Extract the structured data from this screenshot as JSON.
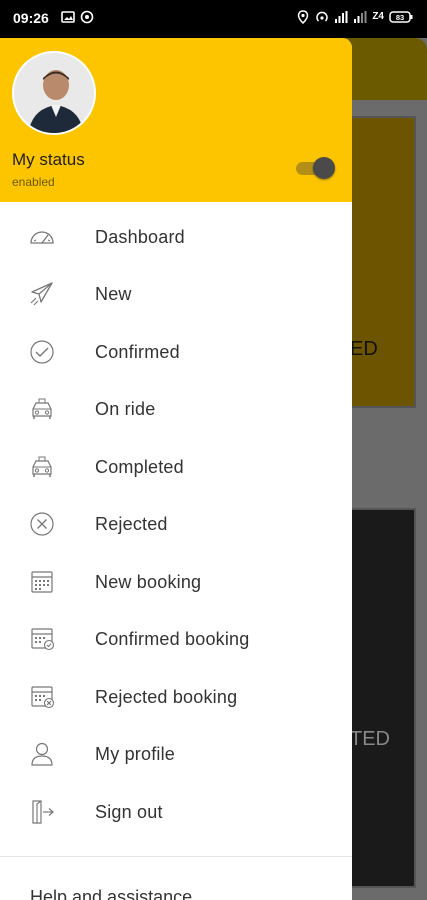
{
  "status_bar": {
    "time": "09:26",
    "network_label": "Z4",
    "battery_label": "83",
    "left_icons": [
      "gallery-icon",
      "whatsapp-icon"
    ],
    "right_icons": [
      "location-icon",
      "hotspot-icon",
      "signal-icon",
      "signal-icon",
      "network-speed",
      "battery-icon"
    ]
  },
  "drawer": {
    "header": {
      "avatar": "profile-photo",
      "status_title": "My status",
      "status_value": "enabled",
      "toggle_on": true
    },
    "menu_items": [
      {
        "label": "Dashboard",
        "icon": "dashboard-gauge-icon"
      },
      {
        "label": "New",
        "icon": "paper-plane-icon"
      },
      {
        "label": "Confirmed",
        "icon": "check-circle-icon"
      },
      {
        "label": "On ride",
        "icon": "car-icon"
      },
      {
        "label": "Completed",
        "icon": "car-icon"
      },
      {
        "label": "Rejected",
        "icon": "x-circle-icon"
      },
      {
        "label": "New booking",
        "icon": "calendar-icon"
      },
      {
        "label": "Confirmed booking",
        "icon": "calendar-check-icon"
      },
      {
        "label": "Rejected booking",
        "icon": "calendar-x-icon"
      },
      {
        "label": "My profile",
        "icon": "user-icon"
      },
      {
        "label": "Sign out",
        "icon": "sign-out-icon"
      }
    ],
    "help_label": "Help and assistance"
  },
  "background": {
    "card1_text": "ED",
    "card2_text": "TED"
  },
  "colors": {
    "accent": "#fdc500",
    "drawer_bg": "#ffffff",
    "text": "#333333"
  }
}
